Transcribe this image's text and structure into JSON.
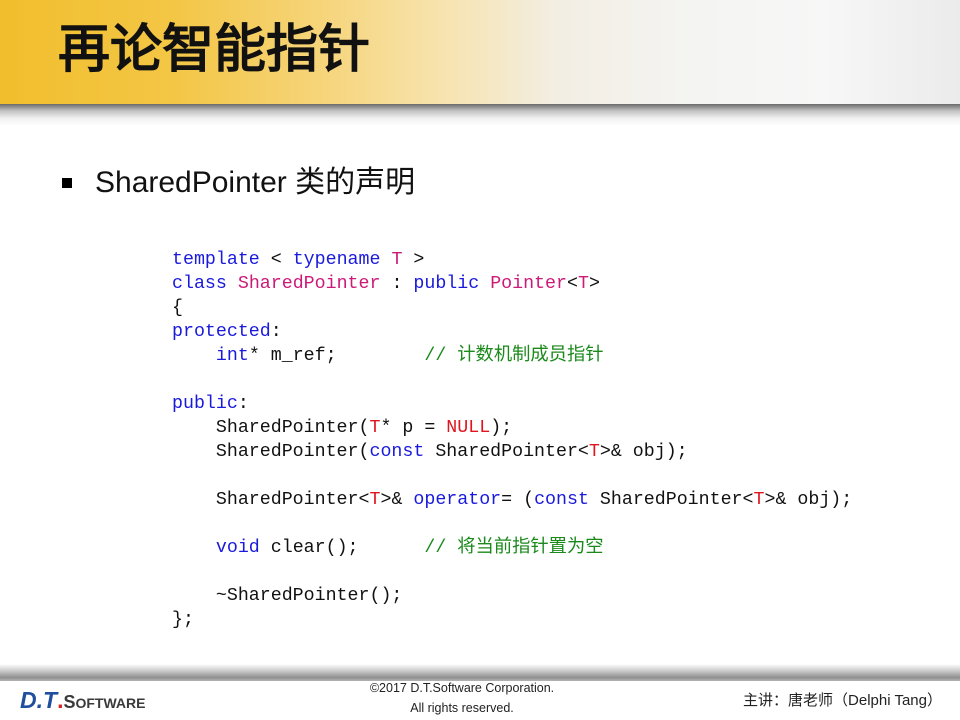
{
  "header": {
    "title": "再论智能指针"
  },
  "bullet": {
    "text": "SharedPointer 类的声明"
  },
  "code": {
    "lines": [
      {
        "tokens": [
          {
            "text": "template",
            "color": "#1a1adc"
          },
          {
            "text": " < ",
            "color": "#111111"
          },
          {
            "text": "typename",
            "color": "#1a1adc"
          },
          {
            "text": " ",
            "color": "#111111"
          },
          {
            "text": "T",
            "color": "#cc1a78"
          },
          {
            "text": " >",
            "color": "#111111"
          }
        ]
      },
      {
        "tokens": [
          {
            "text": "class",
            "color": "#1a1adc"
          },
          {
            "text": " ",
            "color": "#111111"
          },
          {
            "text": "SharedPointer",
            "color": "#cc1a78"
          },
          {
            "text": " : ",
            "color": "#111111"
          },
          {
            "text": "public",
            "color": "#1a1adc"
          },
          {
            "text": " ",
            "color": "#111111"
          },
          {
            "text": "Pointer",
            "color": "#cc1a78"
          },
          {
            "text": "<",
            "color": "#111111"
          },
          {
            "text": "T",
            "color": "#cc1a78"
          },
          {
            "text": ">",
            "color": "#111111"
          }
        ]
      },
      {
        "tokens": [
          {
            "text": "{",
            "color": "#111111"
          }
        ]
      },
      {
        "tokens": [
          {
            "text": "protected",
            "color": "#1a1adc"
          },
          {
            "text": ":",
            "color": "#111111"
          }
        ]
      },
      {
        "tokens": [
          {
            "text": "    ",
            "color": "#111111"
          },
          {
            "text": "int",
            "color": "#1a1adc"
          },
          {
            "text": "* m_ref;        ",
            "color": "#111111"
          },
          {
            "text": "// 计数机制成员指针",
            "color": "#1b8a1b"
          }
        ]
      },
      {
        "tokens": []
      },
      {
        "tokens": [
          {
            "text": "public",
            "color": "#1a1adc"
          },
          {
            "text": ":",
            "color": "#111111"
          }
        ]
      },
      {
        "tokens": [
          {
            "text": "    SharedPointer(",
            "color": "#111111"
          },
          {
            "text": "T",
            "color": "#e0151f"
          },
          {
            "text": "* p = ",
            "color": "#111111"
          },
          {
            "text": "NULL",
            "color": "#e0151f"
          },
          {
            "text": ");",
            "color": "#111111"
          }
        ]
      },
      {
        "tokens": [
          {
            "text": "    SharedPointer(",
            "color": "#111111"
          },
          {
            "text": "const",
            "color": "#1a1adc"
          },
          {
            "text": " SharedPointer<",
            "color": "#111111"
          },
          {
            "text": "T",
            "color": "#e0151f"
          },
          {
            "text": ">& obj);",
            "color": "#111111"
          }
        ]
      },
      {
        "tokens": []
      },
      {
        "tokens": [
          {
            "text": "    SharedPointer<",
            "color": "#111111"
          },
          {
            "text": "T",
            "color": "#e0151f"
          },
          {
            "text": ">& ",
            "color": "#111111"
          },
          {
            "text": "operator",
            "color": "#1a1adc"
          },
          {
            "text": "= (",
            "color": "#111111"
          },
          {
            "text": "const",
            "color": "#1a1adc"
          },
          {
            "text": " SharedPointer<",
            "color": "#111111"
          },
          {
            "text": "T",
            "color": "#e0151f"
          },
          {
            "text": ">& obj);",
            "color": "#111111"
          }
        ]
      },
      {
        "tokens": []
      },
      {
        "tokens": [
          {
            "text": "    ",
            "color": "#111111"
          },
          {
            "text": "void",
            "color": "#1a1adc"
          },
          {
            "text": " clear();      ",
            "color": "#111111"
          },
          {
            "text": "// 将当前指针置为空",
            "color": "#1b8a1b"
          }
        ]
      },
      {
        "tokens": []
      },
      {
        "tokens": [
          {
            "text": "    ~SharedPointer();",
            "color": "#111111"
          }
        ]
      },
      {
        "tokens": [
          {
            "text": "};",
            "color": "#111111"
          }
        ]
      }
    ]
  },
  "footer": {
    "logo": {
      "initials": "D.T",
      "dot": ".",
      "name_initial": "S",
      "name_rest": "OFTWARE"
    },
    "copyright": "©2017 D.T.Software Corporation.",
    "rights": "All rights reserved.",
    "lecturer": "主讲：唐老师（Delphi Tang）"
  },
  "theme": {
    "header_yellow": "#f1be2c",
    "logo_blue": "#1f4e9c",
    "logo_red": "#e02020",
    "logo_gray": "#3a3a3a"
  }
}
